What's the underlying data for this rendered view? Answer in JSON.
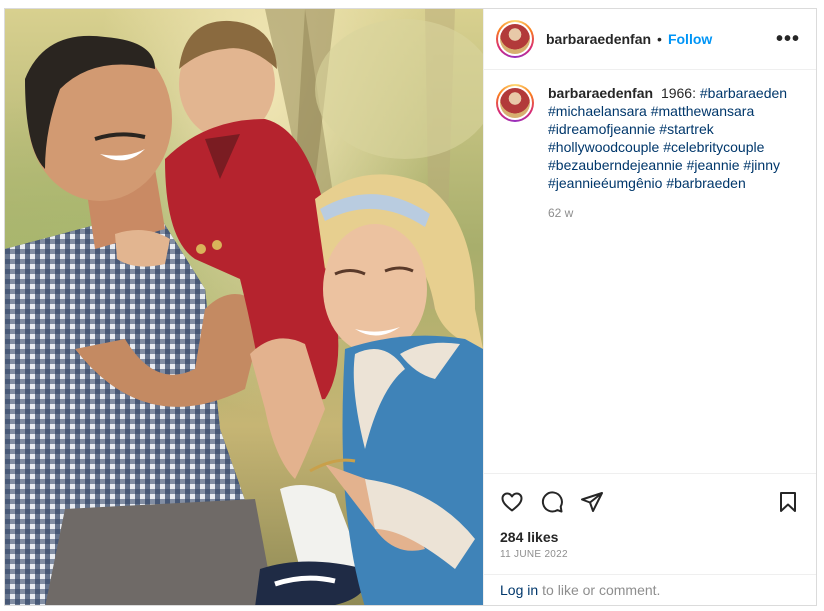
{
  "post": {
    "photo_alt": "",
    "username": "barbaraedenfan",
    "dot": "•",
    "follow_label": "Follow",
    "more_label": "•••"
  },
  "caption": {
    "username": "barbaraedenfan",
    "text": "1966:",
    "hashtags": [
      "#barbaraeden",
      "#michaelansara",
      "#matthewansara",
      "#idreamofjeannie",
      "#startrek",
      "#hollywoodcouple",
      "#celebritycouple",
      "#bezauberndejeannie",
      "#jeannie",
      "#jinny",
      "#jeannieéumgênio",
      "#barbraeden"
    ],
    "time": "62 w"
  },
  "actions": {
    "icons": [
      "heart-icon",
      "comment-icon",
      "share-icon",
      "bookmark-icon"
    ]
  },
  "stats": {
    "likes": "284 likes",
    "date": "11 JUNE 2022"
  },
  "login": {
    "link": "Log in",
    "text": "to like or comment."
  },
  "colors": {
    "accent": "#0095f6",
    "hashtag": "#00376b",
    "muted": "#8e8e8e"
  }
}
